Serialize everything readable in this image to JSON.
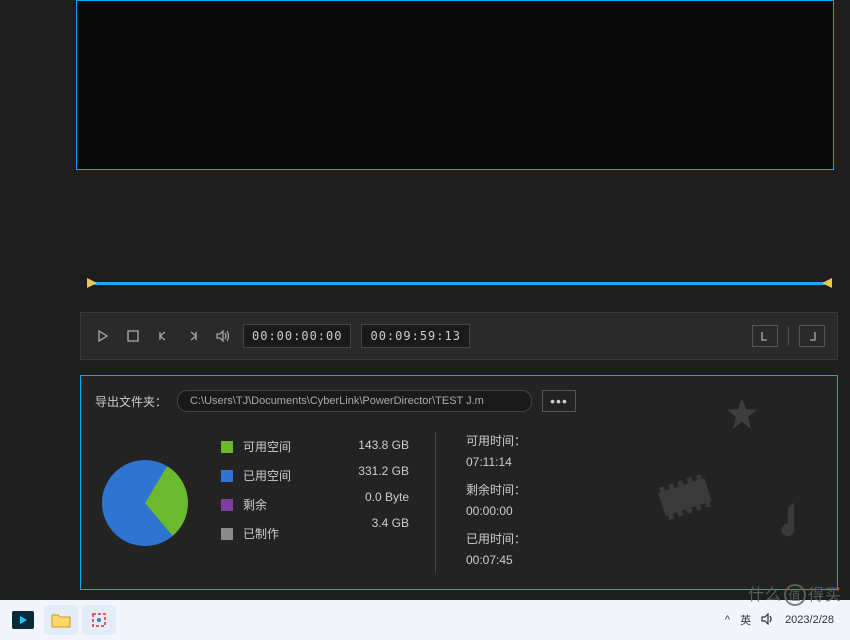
{
  "preview": {
    "current_time": "00:00:00:00",
    "total_time": "00:09:59:13"
  },
  "export": {
    "label": "导出文件夹：",
    "path": "C:\\Users\\TJ\\Documents\\CyberLink\\PowerDirector\\TEST J.m"
  },
  "legend": {
    "available": {
      "label": "可用空间",
      "value": "143.8  GB",
      "color": "#6ab92f"
    },
    "used": {
      "label": "已用空间",
      "value": "331.2  GB",
      "color": "#2f74d0"
    },
    "remaining": {
      "label": "剩余",
      "value": "0.0  Byte",
      "color": "#7a3fa0"
    },
    "produced": {
      "label": "已制作",
      "value": "3.4  GB",
      "color": "#8a8a8a"
    }
  },
  "timeinfo": {
    "avail_label": "可用时间：",
    "avail_value": "07:11:14",
    "remain_label": "剩余时间：",
    "remain_value": "00:00:00",
    "elapsed_label": "已用时间：",
    "elapsed_value": "00:07:45"
  },
  "tray": {
    "chevron": "^",
    "lang": "英",
    "date": "2023/2/28"
  },
  "watermark": {
    "pre": "什么",
    "mid": "值",
    "post": "得买"
  },
  "chart_data": {
    "type": "pie",
    "title": "Disk usage",
    "series": [
      {
        "name": "已用空间",
        "value": 331.2,
        "unit": "GB",
        "color": "#2f74d0"
      },
      {
        "name": "可用空间",
        "value": 143.8,
        "unit": "GB",
        "color": "#6ab92f"
      }
    ]
  }
}
